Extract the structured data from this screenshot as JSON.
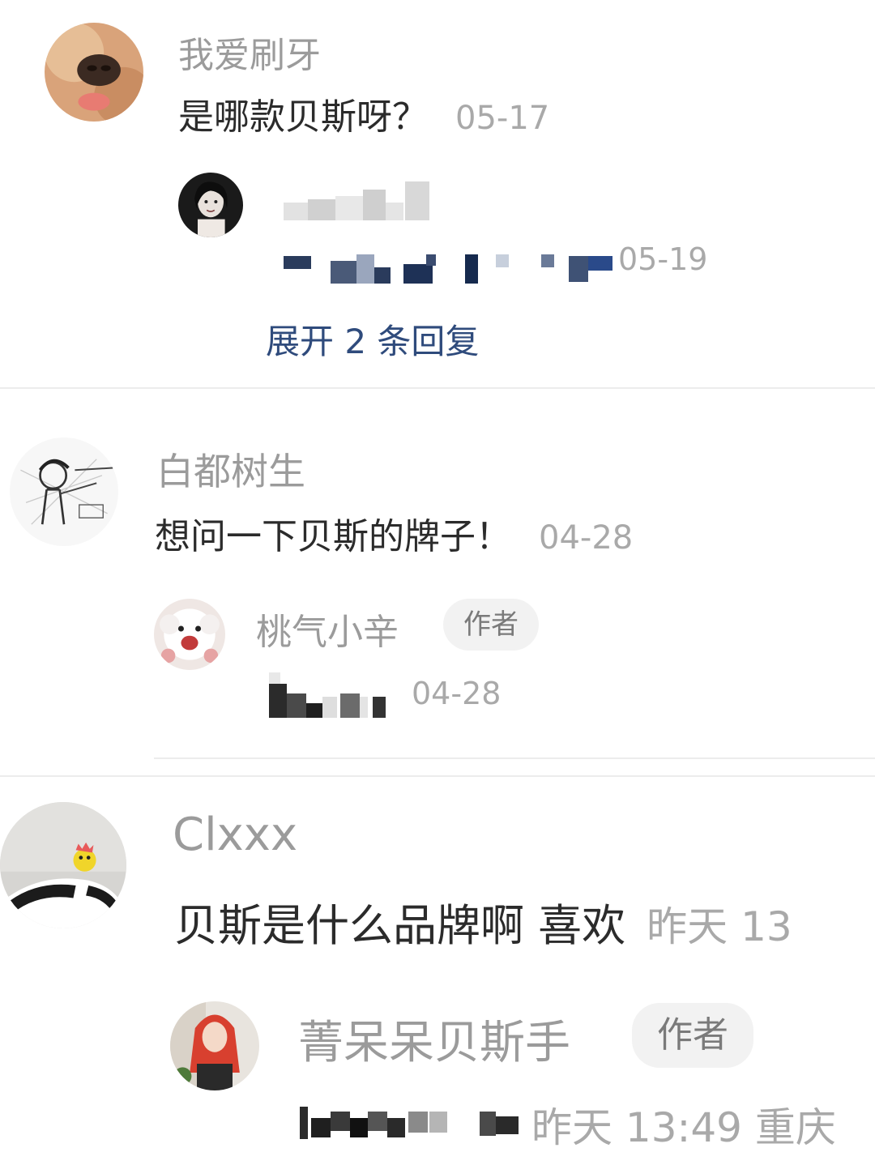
{
  "comments": [
    {
      "username": "我爱刷牙",
      "text": "是哪款贝斯呀？",
      "time": "05-17",
      "avatar": "dog-nose-avatar",
      "reply": {
        "avatar": "woman-portrait-avatar",
        "time": "05-19",
        "redacted": true
      },
      "expand_label": "展开 2 条回复"
    },
    {
      "username": "白都树生",
      "text": "想问一下贝斯的牌子！",
      "time": "04-28",
      "avatar": "sketch-girl-avatar",
      "reply": {
        "username": "桃气小辛",
        "badge": "作者",
        "avatar": "white-puppy-avatar",
        "time": "04-28",
        "redacted": true
      }
    },
    {
      "username": "Clxxx",
      "text": "贝斯是什么品牌啊 喜欢",
      "time": "昨天 13",
      "avatar": "toy-figure-avatar",
      "reply": {
        "username": "菁呆呆贝斯手",
        "badge": "作者",
        "avatar": "red-hair-girl-avatar",
        "time": "昨天 13:49 重庆",
        "redacted": true
      }
    }
  ],
  "colors": {
    "username": "#9b9b9b",
    "text": "#2b2b2b",
    "time": "#a9a9a9",
    "link": "#2f4b7c",
    "badge_bg": "#f2f2f2",
    "divider": "#ececec"
  }
}
